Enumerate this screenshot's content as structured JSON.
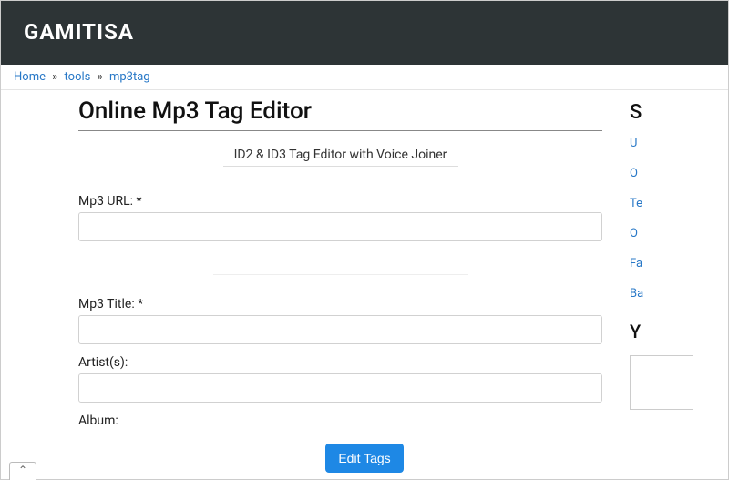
{
  "header": {
    "brand": "GAMITISA"
  },
  "breadcrumb": {
    "home": "Home",
    "tools": "tools",
    "mp3tag": "mp3tag",
    "sep": "»"
  },
  "page": {
    "title": "Online Mp3 Tag Editor",
    "subtitle": "ID2 & ID3 Tag Editor with Voice Joiner"
  },
  "form": {
    "url_label": "Mp3 URL: *",
    "url_value": "",
    "title_label": "Mp3 Title: *",
    "title_value": "",
    "artist_label": "Artist(s):",
    "artist_value": "",
    "album_label": "Album:",
    "album_value": "",
    "submit": "Edit Tags"
  },
  "sidebar": {
    "heading1": "S",
    "links": [
      "U",
      "O",
      "Te",
      "O",
      "Fa",
      "Ba"
    ],
    "heading2": "Y"
  },
  "corner_tab": "⌃"
}
